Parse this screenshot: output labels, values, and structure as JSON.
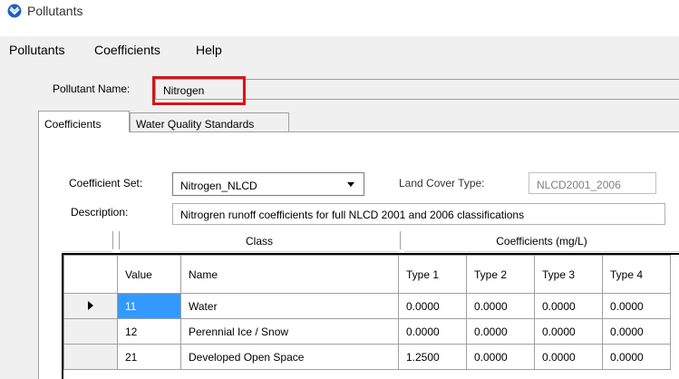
{
  "window": {
    "title": "Pollutants"
  },
  "menu": [
    "Pollutants",
    "Coefficients",
    "Help"
  ],
  "pollutant": {
    "label": "Pollutant Name:",
    "value": "Nitrogen"
  },
  "tabs": [
    "Coefficients",
    "Water Quality Standards"
  ],
  "coefficient_set": {
    "label": "Coefficient Set:",
    "value": "Nitrogen_NLCD"
  },
  "land_cover": {
    "label": "Land Cover Type:",
    "value": "NLCD2001_2006"
  },
  "description": {
    "label": "Description:",
    "value": "Nitrogren runoff coefficients for full NLCD 2001 and 2006 classifications"
  },
  "group_headers": {
    "class": "Class",
    "coefficients": "Coefficients (mg/L)"
  },
  "table": {
    "columns": [
      "Value",
      "Name",
      "Type 1",
      "Type 2",
      "Type 3",
      "Type 4"
    ],
    "rows": [
      [
        "11",
        "Water",
        "0.0000",
        "0.0000",
        "0.0000",
        "0.0000"
      ],
      [
        "12",
        "Perennial Ice / Snow",
        "0.0000",
        "0.0000",
        "0.0000",
        "0.0000"
      ],
      [
        "21",
        "Developed Open Space",
        "1.2500",
        "0.0000",
        "0.0000",
        "0.0000"
      ]
    ],
    "selected_row": 0
  },
  "colors": {
    "highlight": "#e01010",
    "selection": "#3399ff"
  }
}
